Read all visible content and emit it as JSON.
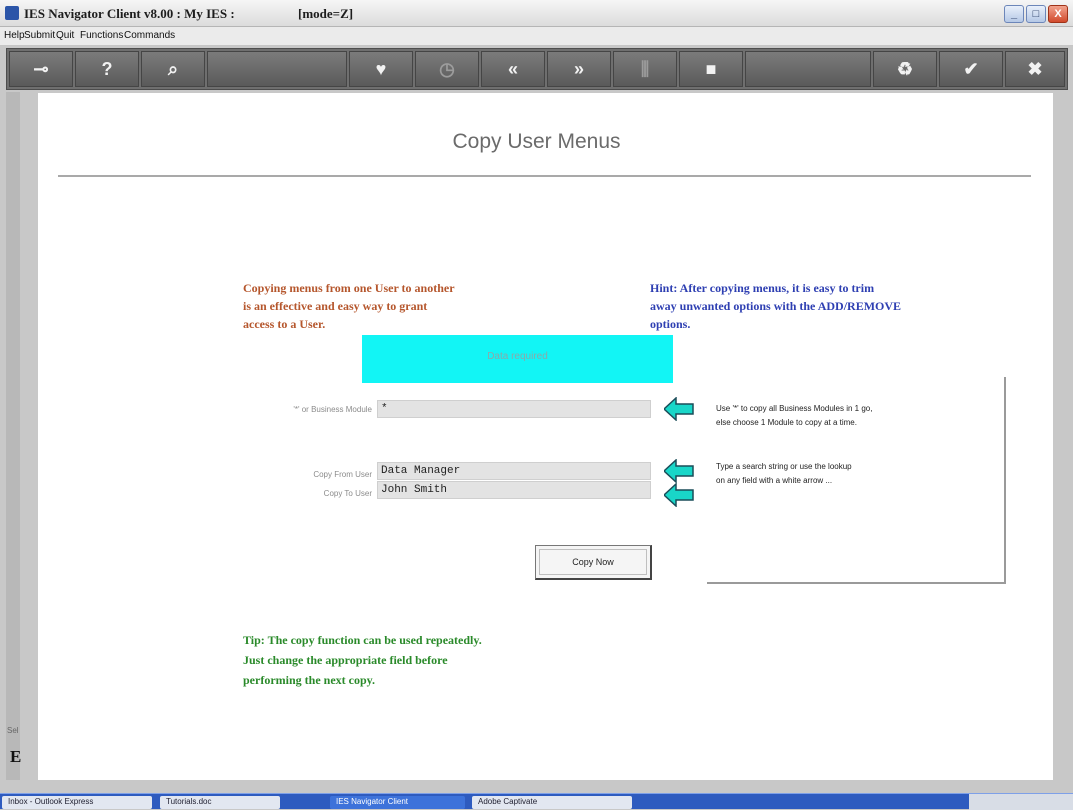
{
  "window": {
    "title": "IES Navigator Client v8.00 : My IES :",
    "mode": "[mode=Z]",
    "controls": {
      "minimize": "_",
      "maximize": "□",
      "close": "X"
    }
  },
  "menubar": {
    "items": [
      "Help",
      "Submit",
      "Quit",
      "Functions",
      "Commands"
    ]
  },
  "toolbar": {
    "buttons": [
      {
        "name": "key-icon",
        "glyph": "⊸"
      },
      {
        "name": "help-icon",
        "glyph": "?"
      },
      {
        "name": "search-icon",
        "glyph": "⌕"
      },
      {
        "name": "heart-icon",
        "glyph": "♥"
      },
      {
        "name": "clock-icon",
        "glyph": "◷"
      },
      {
        "name": "rewind-icon",
        "glyph": "«"
      },
      {
        "name": "forward-icon",
        "glyph": "»"
      },
      {
        "name": "tree-icon",
        "glyph": "⫼"
      },
      {
        "name": "stop-icon",
        "glyph": "■"
      },
      {
        "name": "recycle-icon",
        "glyph": "♻"
      },
      {
        "name": "check-icon",
        "glyph": "✔"
      },
      {
        "name": "close-icon",
        "glyph": "✖"
      }
    ]
  },
  "page": {
    "title": "Copy User Menus",
    "intro_left": [
      "Copying menus from one User to another",
      "is an effective and easy way to grant",
      "access to a User."
    ],
    "intro_right": [
      "Hint: After copying menus, it is easy to trim",
      "away unwanted options with the ADD/REMOVE",
      "options."
    ],
    "banner": "Data required",
    "fields": {
      "module": {
        "label": "'*' or Business Module",
        "value": "*"
      },
      "from_user": {
        "label": "Copy From User",
        "value": "Data Manager"
      },
      "to_user": {
        "label": "Copy To User",
        "value": "John Smith"
      }
    },
    "help": {
      "module_hint": [
        "Use '*' to copy all Business Modules in 1 go,",
        "else choose 1 Module to copy at a time."
      ],
      "lookup_hint": [
        "Type a search string or use the lookup",
        "on any field with a white arrow ..."
      ]
    },
    "copy_button": "Copy Now",
    "tip": [
      "Tip: The copy function can be used repeatedly.",
      "Just change the appropriate field before",
      "performing the next copy."
    ]
  },
  "side": {
    "gutter_label": "Sel",
    "gutter_char": "E"
  },
  "taskbar": {
    "tasks": [
      "Inbox - Outlook Express",
      "Tutorials.doc",
      "IES Navigator Client",
      "Adobe Captivate"
    ]
  },
  "colors": {
    "accent_cyan": "#12f5f5",
    "arrow": "#19d6c8",
    "intro": "#b5562c",
    "hint": "#2e3fb2",
    "tip": "#2a8a2a"
  }
}
